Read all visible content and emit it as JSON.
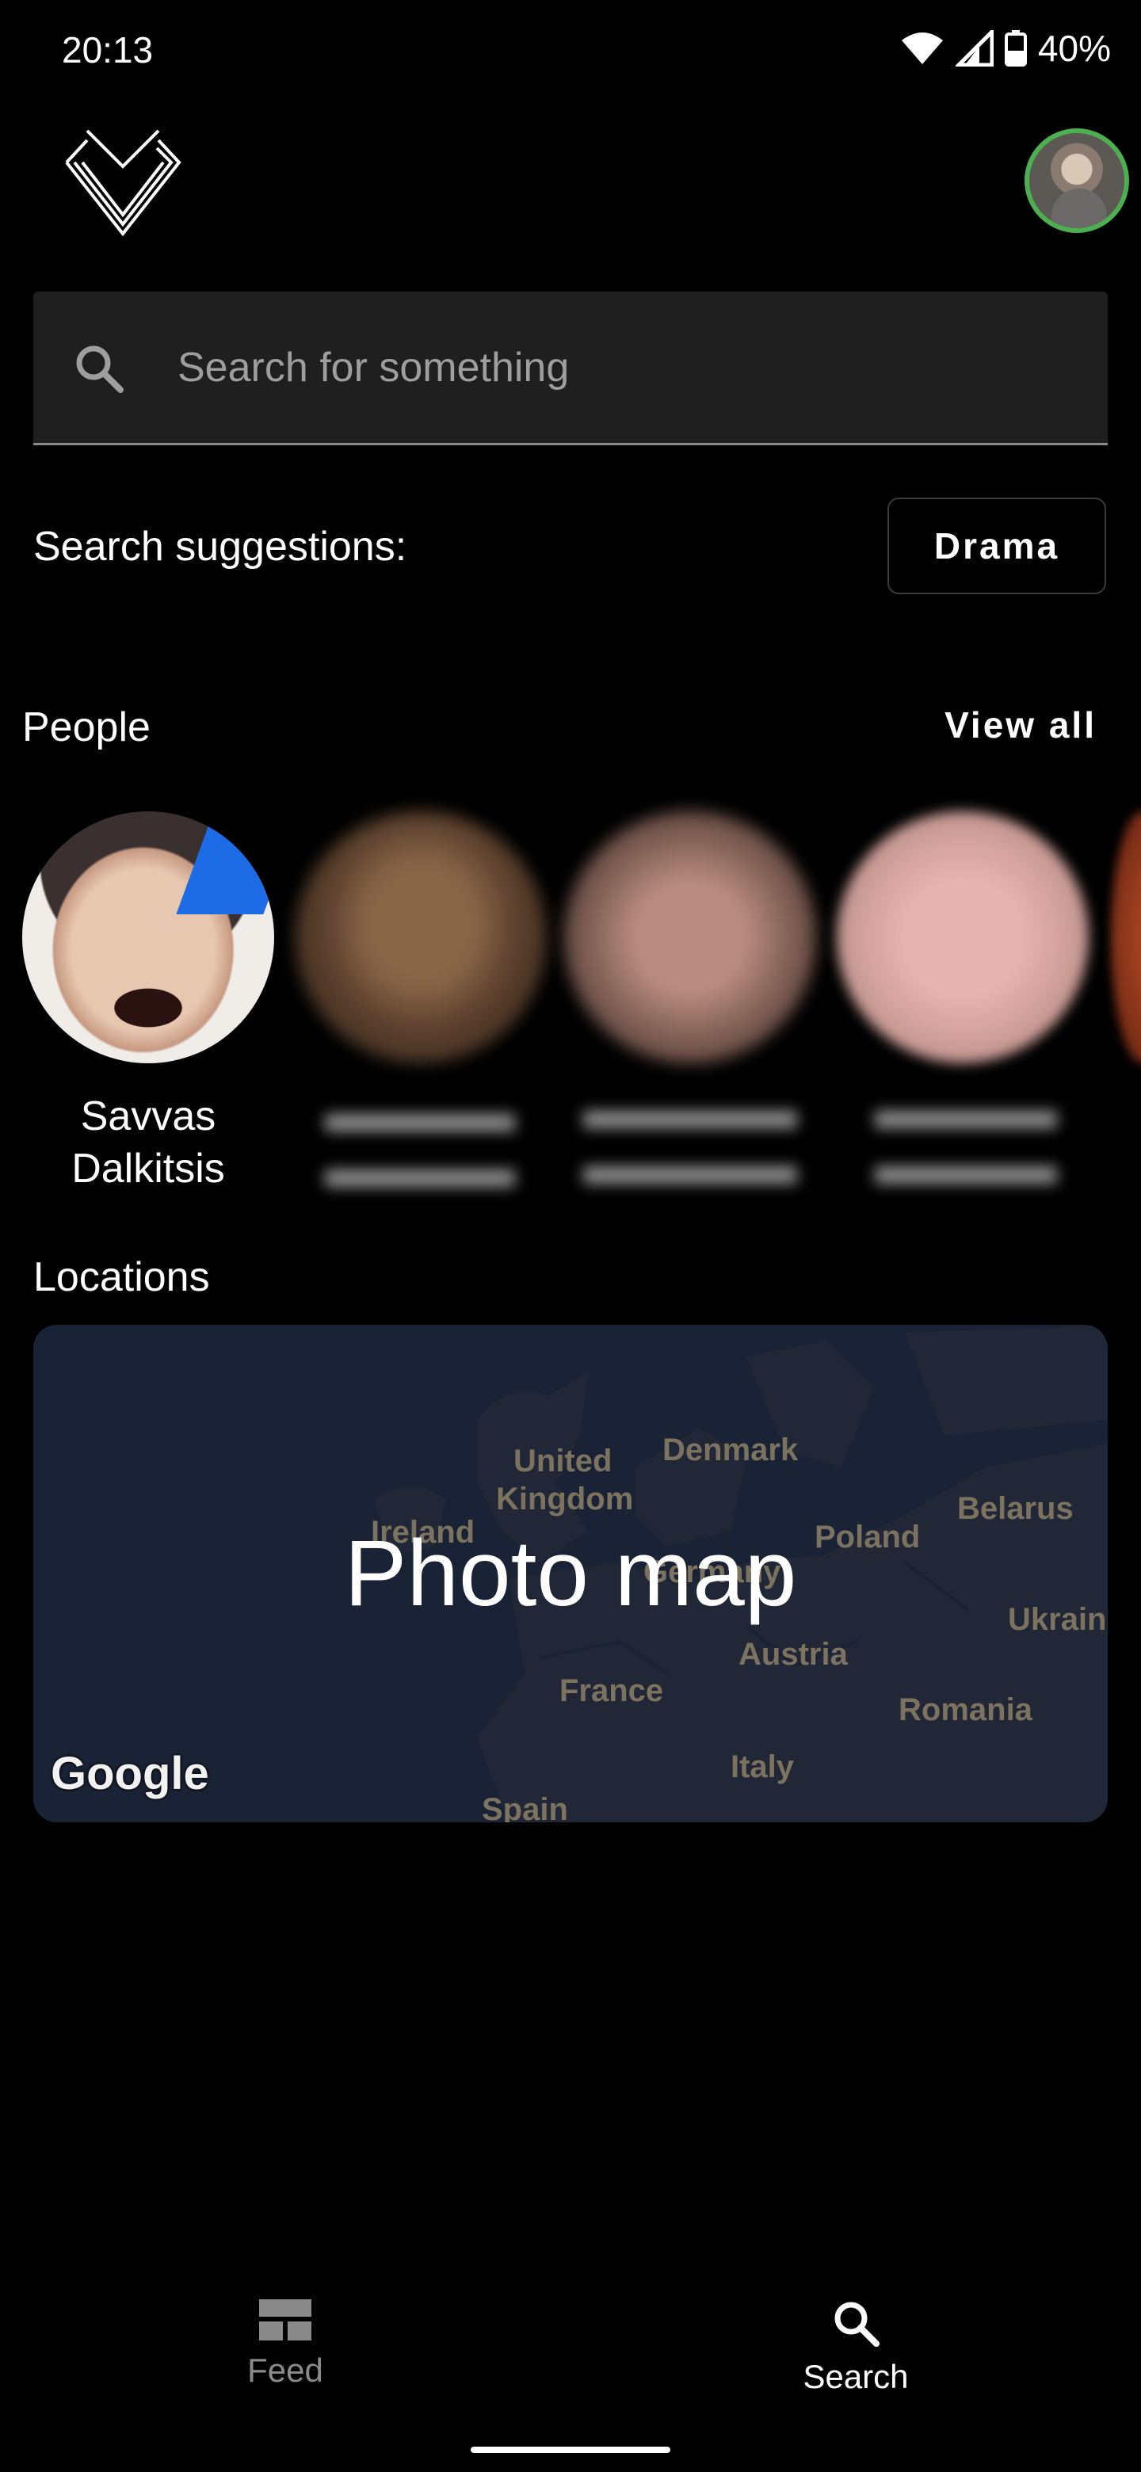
{
  "status_bar": {
    "time": "20:13",
    "battery": "40%",
    "icons": [
      "wifi-icon",
      "signal-icon",
      "battery-icon"
    ]
  },
  "header": {
    "logo_icon": "diamond-logo-icon",
    "avatar_ring_color": "#4caf50"
  },
  "search": {
    "placeholder": "Search for something",
    "icon": "search-icon"
  },
  "suggestions": {
    "label": "Search suggestions:",
    "chips": [
      "Drama"
    ]
  },
  "people": {
    "title": "People",
    "view_all": "View all",
    "items": [
      {
        "name_line1": "Savvas",
        "name_line2": "Dalkitsis"
      }
    ]
  },
  "locations": {
    "title": "Locations",
    "map_title": "Photo map",
    "attribution": "Google",
    "map_labels": [
      "United",
      "Kingdom",
      "Denmark",
      "Ireland",
      "Poland",
      "Belarus",
      "Ukrain",
      "Austria",
      "France",
      "Romania",
      "Germany",
      "Italy",
      "Spain"
    ]
  },
  "bottom_nav": {
    "items": [
      {
        "label": "Feed",
        "icon": "feed-icon",
        "active": false
      },
      {
        "label": "Search",
        "icon": "search-icon",
        "active": true
      }
    ]
  }
}
